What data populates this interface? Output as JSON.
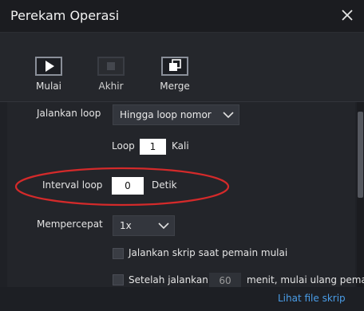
{
  "window": {
    "title": "Perekam Operasi",
    "close_icon": "close-icon"
  },
  "toolbar": {
    "start_label": "Mulai",
    "end_label": "Akhir",
    "merge_label": "Merge"
  },
  "settings": {
    "run_loop_label": "Jalankan loop",
    "run_loop_value": "Hingga loop nomor",
    "loop_prefix": "Loop",
    "loop_count": "1",
    "loop_suffix": "Kali",
    "interval_label": "Interval loop",
    "interval_value": "0",
    "interval_unit": "Detik",
    "speed_label": "Mempercepat",
    "speed_value": "1x",
    "run_on_start_label": "Jalankan skrip saat pemain mulai",
    "after_run_prefix": "Setelah jalankan",
    "after_run_value": "60",
    "after_run_suffix": "menit, mulai ulang pemai"
  },
  "footer": {
    "view_script_link": "Lihat file skrip"
  },
  "colors": {
    "accent_link": "#4a9de8",
    "annotation": "#d42a2a"
  }
}
